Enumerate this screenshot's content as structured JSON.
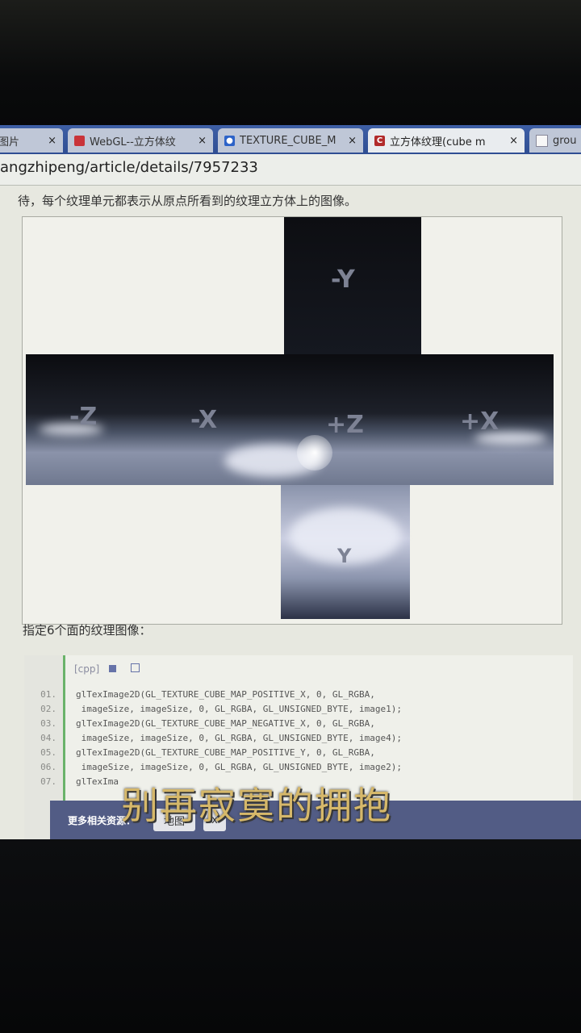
{
  "browser": {
    "tabs": [
      {
        "label": "图片",
        "icon": "page-icon",
        "active": false
      },
      {
        "label": "WebGL--立方体纹",
        "icon": "bookmark-icon",
        "active": false
      },
      {
        "label": "TEXTURE_CUBE_M",
        "icon": "paw-icon",
        "active": false
      },
      {
        "label": "立方体纹理(cube m",
        "icon": "csdn-c-icon",
        "active": true
      },
      {
        "label": "grou",
        "icon": "document-icon",
        "active": false
      }
    ],
    "close_glyph": "×",
    "address": "angzhipeng/article/details/7957233"
  },
  "article": {
    "intro": "待，每个纹理单元都表示从原点所看到的纹理立方体上的图像。",
    "cubemap_labels": {
      "neg_y": "-Y",
      "neg_z": "-Z",
      "neg_x": "-X",
      "pos_z": "+Z",
      "pos_x": "+X",
      "pos_y": "Y"
    },
    "spec_text": "指定6个面的纹理图像：",
    "code_toolbar": "[cpp]",
    "code_lines": [
      {
        "n": "01.",
        "t": "glTexImage2D(GL_TEXTURE_CUBE_MAP_POSITIVE_X, 0, GL_RGBA,"
      },
      {
        "n": "02.",
        "t": " imageSize, imageSize, 0, GL_RGBA, GL_UNSIGNED_BYTE, image1);"
      },
      {
        "n": "03.",
        "t": "glTexImage2D(GL_TEXTURE_CUBE_MAP_NEGATIVE_X, 0, GL_RGBA,"
      },
      {
        "n": "04.",
        "t": " imageSize, imageSize, 0, GL_RGBA, GL_UNSIGNED_BYTE, image4);"
      },
      {
        "n": "05.",
        "t": "glTexImage2D(GL_TEXTURE_CUBE_MAP_POSITIVE_Y, 0, GL_RGBA,"
      },
      {
        "n": "06.",
        "t": " imageSize, imageSize, 0, GL_RGBA, GL_UNSIGNED_BYTE, image2);"
      },
      {
        "n": "07.",
        "t": "glTexIma"
      }
    ]
  },
  "footer": {
    "label": "更多相关资源：",
    "button1": "地图",
    "button2": "x"
  },
  "overlay": {
    "subtitle": "别再寂寞的拥抱"
  },
  "colors": {
    "tabbar": "#3e5fa6",
    "footer": "#525c85",
    "subtitle": "#d6b86a"
  }
}
